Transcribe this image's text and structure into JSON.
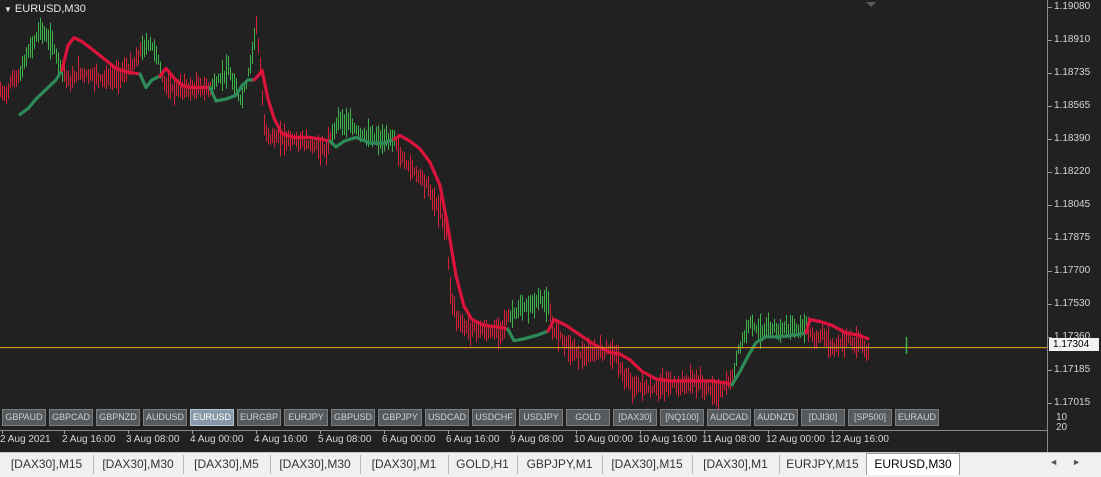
{
  "window": {
    "title": "EURUSD,M30",
    "colors": {
      "background": "#212121",
      "bull": "#2e8b57",
      "bear": "#dc143c",
      "candle_bull": "#3cb34a",
      "candle_bear": "#d3213a",
      "bid_line": "#f5a623"
    }
  },
  "price_axis": {
    "labels": [
      "1.19080",
      "1.18910",
      "1.18735",
      "1.18565",
      "1.18390",
      "1.18220",
      "1.18045",
      "1.17875",
      "1.17700",
      "1.17530",
      "1.17360",
      "1.17185",
      "1.17015"
    ],
    "current_price": "1.17304",
    "corner_labels": [
      "10",
      "20"
    ]
  },
  "time_axis": {
    "labels": [
      "2 Aug 2021",
      "2 Aug 16:00",
      "3 Aug 08:00",
      "4 Aug 00:00",
      "4 Aug 16:00",
      "5 Aug 08:00",
      "6 Aug 00:00",
      "6 Aug 16:00",
      "9 Aug 08:00",
      "10 Aug 00:00",
      "10 Aug 16:00",
      "11 Aug 08:00",
      "12 Aug 00:00",
      "12 Aug 16:00"
    ]
  },
  "symbol_buttons": [
    {
      "label": "GBPAUD",
      "active": false
    },
    {
      "label": "GBPCAD",
      "active": false
    },
    {
      "label": "GBPNZD",
      "active": false
    },
    {
      "label": "AUDUSD",
      "active": false
    },
    {
      "label": "EURUSD",
      "active": true
    },
    {
      "label": "EURGBP",
      "active": false
    },
    {
      "label": "EURJPY",
      "active": false
    },
    {
      "label": "GBPUSD",
      "active": false
    },
    {
      "label": "GBPJPY",
      "active": false
    },
    {
      "label": "USDCAD",
      "active": false
    },
    {
      "label": "USDCHF",
      "active": false
    },
    {
      "label": "USDJPY",
      "active": false
    },
    {
      "label": "GOLD",
      "active": false
    },
    {
      "label": "[DAX30]",
      "active": false
    },
    {
      "label": "[NQ100]",
      "active": false
    },
    {
      "label": "AUDCAD",
      "active": false
    },
    {
      "label": "AUDNZD",
      "active": false
    },
    {
      "label": "[DJI30]",
      "active": false
    },
    {
      "label": "[SP500]",
      "active": false
    },
    {
      "label": "EURAUD",
      "active": false
    }
  ],
  "tabs": [
    {
      "label": "[DAX30],M15",
      "active": false
    },
    {
      "label": "[DAX30],M30",
      "active": false
    },
    {
      "label": "[DAX30],M5",
      "active": false
    },
    {
      "label": "[DAX30],M30",
      "active": false
    },
    {
      "label": "[DAX30],M1",
      "active": false
    },
    {
      "label": "GOLD,H1",
      "active": false
    },
    {
      "label": "GBPJPY,M1",
      "active": false
    },
    {
      "label": "[DAX30],M15",
      "active": false
    },
    {
      "label": "[DAX30],M1",
      "active": false
    },
    {
      "label": "EURJPY,M15",
      "active": false
    },
    {
      "label": "EURUSD,M30",
      "active": true
    }
  ],
  "chart_data": {
    "type": "line",
    "symbol": "EURUSD",
    "timeframe": "M30",
    "ylim": [
      1.1699,
      1.191
    ],
    "current_price": 1.17304,
    "price_path": [
      [
        0,
        1.1864
      ],
      [
        5,
        1.1862
      ],
      [
        12,
        1.187
      ],
      [
        20,
        1.1873
      ],
      [
        26,
        1.1882
      ],
      [
        34,
        1.189
      ],
      [
        40,
        1.1897
      ],
      [
        46,
        1.1892
      ],
      [
        52,
        1.1889
      ],
      [
        58,
        1.188
      ],
      [
        64,
        1.1874
      ],
      [
        70,
        1.1868
      ],
      [
        78,
        1.1874
      ],
      [
        86,
        1.1873
      ],
      [
        94,
        1.1872
      ],
      [
        102,
        1.1871
      ],
      [
        110,
        1.1871
      ],
      [
        118,
        1.1872
      ],
      [
        126,
        1.1875
      ],
      [
        134,
        1.1878
      ],
      [
        140,
        1.1885
      ],
      [
        146,
        1.1888
      ],
      [
        150,
        1.1889
      ],
      [
        156,
        1.1884
      ],
      [
        162,
        1.1871
      ],
      [
        168,
        1.1866
      ],
      [
        176,
        1.1865
      ],
      [
        184,
        1.1866
      ],
      [
        192,
        1.1865
      ],
      [
        198,
        1.1866
      ],
      [
        204,
        1.1865
      ],
      [
        210,
        1.1866
      ],
      [
        216,
        1.1869
      ],
      [
        222,
        1.1872
      ],
      [
        228,
        1.1875
      ],
      [
        234,
        1.1866
      ],
      [
        240,
        1.186
      ],
      [
        246,
        1.1868
      ],
      [
        252,
        1.1885
      ],
      [
        256,
        1.19
      ],
      [
        260,
        1.1875
      ],
      [
        264,
        1.1845
      ],
      [
        270,
        1.184
      ],
      [
        278,
        1.184
      ],
      [
        290,
        1.1839
      ],
      [
        300,
        1.1838
      ],
      [
        310,
        1.1836
      ],
      [
        318,
        1.1835
      ],
      [
        326,
        1.1833
      ],
      [
        332,
        1.1842
      ],
      [
        338,
        1.185
      ],
      [
        344,
        1.1848
      ],
      [
        350,
        1.1846
      ],
      [
        356,
        1.1844
      ],
      [
        362,
        1.1842
      ],
      [
        370,
        1.184
      ],
      [
        378,
        1.1839
      ],
      [
        386,
        1.1838
      ],
      [
        394,
        1.184
      ],
      [
        400,
        1.183
      ],
      [
        410,
        1.1824
      ],
      [
        420,
        1.182
      ],
      [
        428,
        1.1814
      ],
      [
        434,
        1.1806
      ],
      [
        440,
        1.1801
      ],
      [
        446,
        1.179
      ],
      [
        450,
        1.176
      ],
      [
        456,
        1.1746
      ],
      [
        462,
        1.1742
      ],
      [
        470,
        1.174
      ],
      [
        480,
        1.174
      ],
      [
        490,
        1.1738
      ],
      [
        500,
        1.174
      ],
      [
        506,
        1.1745
      ],
      [
        512,
        1.1748
      ],
      [
        520,
        1.175
      ],
      [
        530,
        1.1752
      ],
      [
        540,
        1.1756
      ],
      [
        548,
        1.1752
      ],
      [
        552,
        1.174
      ],
      [
        558,
        1.1738
      ],
      [
        564,
        1.1734
      ],
      [
        570,
        1.173
      ],
      [
        578,
        1.1727
      ],
      [
        586,
        1.1726
      ],
      [
        596,
        1.1728
      ],
      [
        606,
        1.1729
      ],
      [
        614,
        1.1728
      ],
      [
        620,
        1.172
      ],
      [
        626,
        1.1713
      ],
      [
        634,
        1.171
      ],
      [
        642,
        1.171
      ],
      [
        650,
        1.1708
      ],
      [
        660,
        1.171
      ],
      [
        670,
        1.1712
      ],
      [
        680,
        1.171
      ],
      [
        690,
        1.1713
      ],
      [
        700,
        1.1712
      ],
      [
        706,
        1.1709
      ],
      [
        712,
        1.1708
      ],
      [
        718,
        1.1706
      ],
      [
        724,
        1.171
      ],
      [
        730,
        1.1712
      ],
      [
        734,
        1.1718
      ],
      [
        738,
        1.173
      ],
      [
        744,
        1.1736
      ],
      [
        750,
        1.1745
      ],
      [
        756,
        1.174
      ],
      [
        764,
        1.1739
      ],
      [
        772,
        1.174
      ],
      [
        780,
        1.174
      ],
      [
        790,
        1.1741
      ],
      [
        800,
        1.1739
      ],
      [
        806,
        1.1744
      ],
      [
        810,
        1.1738
      ],
      [
        816,
        1.1734
      ],
      [
        822,
        1.1738
      ],
      [
        828,
        1.1733
      ],
      [
        834,
        1.173
      ],
      [
        840,
        1.1733
      ],
      [
        848,
        1.1736
      ],
      [
        854,
        1.1731
      ],
      [
        860,
        1.1733
      ],
      [
        866,
        1.1729
      ],
      [
        906,
        1.17304
      ]
    ],
    "trend_line": [
      {
        "color": "bull",
        "points": [
          [
            20,
            1.1852
          ],
          [
            28,
            1.1855
          ],
          [
            36,
            1.186
          ],
          [
            46,
            1.1865
          ],
          [
            56,
            1.187
          ],
          [
            62,
            1.1875
          ]
        ]
      },
      {
        "color": "bear",
        "points": [
          [
            62,
            1.1875
          ],
          [
            68,
            1.1888
          ],
          [
            74,
            1.1892
          ],
          [
            82,
            1.189
          ],
          [
            92,
            1.1886
          ],
          [
            104,
            1.1881
          ],
          [
            116,
            1.1876
          ],
          [
            128,
            1.1874
          ],
          [
            140,
            1.1873
          ]
        ]
      },
      {
        "color": "bull",
        "points": [
          [
            140,
            1.1873
          ],
          [
            146,
            1.1866
          ],
          [
            152,
            1.187
          ],
          [
            160,
            1.1872
          ]
        ]
      },
      {
        "color": "bear",
        "points": [
          [
            160,
            1.1872
          ],
          [
            166,
            1.1876
          ],
          [
            174,
            1.1871
          ],
          [
            182,
            1.1867
          ],
          [
            190,
            1.1866
          ],
          [
            200,
            1.1866
          ],
          [
            210,
            1.1866
          ]
        ]
      },
      {
        "color": "bull",
        "points": [
          [
            210,
            1.1866
          ],
          [
            216,
            1.1859
          ],
          [
            226,
            1.186
          ],
          [
            236,
            1.1862
          ],
          [
            242,
            1.1867
          ],
          [
            248,
            1.187
          ],
          [
            254,
            1.187
          ]
        ]
      },
      {
        "color": "bear",
        "points": [
          [
            254,
            1.187
          ],
          [
            258,
            1.1872
          ],
          [
            262,
            1.1875
          ],
          [
            268,
            1.186
          ],
          [
            274,
            1.185
          ],
          [
            282,
            1.1842
          ],
          [
            294,
            1.184
          ],
          [
            310,
            1.184
          ],
          [
            322,
            1.1839
          ],
          [
            330,
            1.1838
          ]
        ]
      },
      {
        "color": "bull",
        "points": [
          [
            330,
            1.1838
          ],
          [
            336,
            1.1835
          ],
          [
            344,
            1.1838
          ],
          [
            356,
            1.184
          ],
          [
            370,
            1.1837
          ],
          [
            384,
            1.1837
          ],
          [
            394,
            1.1839
          ]
        ]
      },
      {
        "color": "bear",
        "points": [
          [
            394,
            1.1839
          ],
          [
            400,
            1.1841
          ],
          [
            410,
            1.1838
          ],
          [
            420,
            1.1834
          ],
          [
            430,
            1.1827
          ],
          [
            440,
            1.1815
          ],
          [
            448,
            1.1793
          ],
          [
            456,
            1.1768
          ],
          [
            464,
            1.1752
          ],
          [
            472,
            1.1745
          ],
          [
            484,
            1.1742
          ],
          [
            500,
            1.1741
          ],
          [
            508,
            1.174
          ]
        ]
      },
      {
        "color": "bull",
        "points": [
          [
            508,
            1.174
          ],
          [
            514,
            1.1734
          ],
          [
            524,
            1.1735
          ],
          [
            538,
            1.1737
          ],
          [
            548,
            1.1739
          ]
        ]
      },
      {
        "color": "bear",
        "points": [
          [
            548,
            1.1739
          ],
          [
            554,
            1.1745
          ],
          [
            566,
            1.1742
          ],
          [
            580,
            1.1737
          ],
          [
            594,
            1.1732
          ],
          [
            610,
            1.1728
          ],
          [
            620,
            1.1727
          ],
          [
            630,
            1.1724
          ],
          [
            642,
            1.1718
          ],
          [
            656,
            1.1714
          ],
          [
            670,
            1.1713
          ],
          [
            690,
            1.1713
          ],
          [
            710,
            1.1713
          ],
          [
            726,
            1.1712
          ],
          [
            732,
            1.1711
          ]
        ]
      },
      {
        "color": "bull",
        "points": [
          [
            732,
            1.1711
          ],
          [
            740,
            1.1718
          ],
          [
            748,
            1.1726
          ],
          [
            756,
            1.1733
          ],
          [
            766,
            1.1736
          ],
          [
            780,
            1.1736
          ],
          [
            796,
            1.1737
          ],
          [
            806,
            1.1738
          ]
        ]
      },
      {
        "color": "bear",
        "points": [
          [
            806,
            1.1738
          ],
          [
            810,
            1.1745
          ],
          [
            820,
            1.1744
          ],
          [
            832,
            1.1742
          ],
          [
            846,
            1.1738
          ],
          [
            858,
            1.1737
          ],
          [
            868,
            1.1735
          ]
        ]
      }
    ]
  }
}
